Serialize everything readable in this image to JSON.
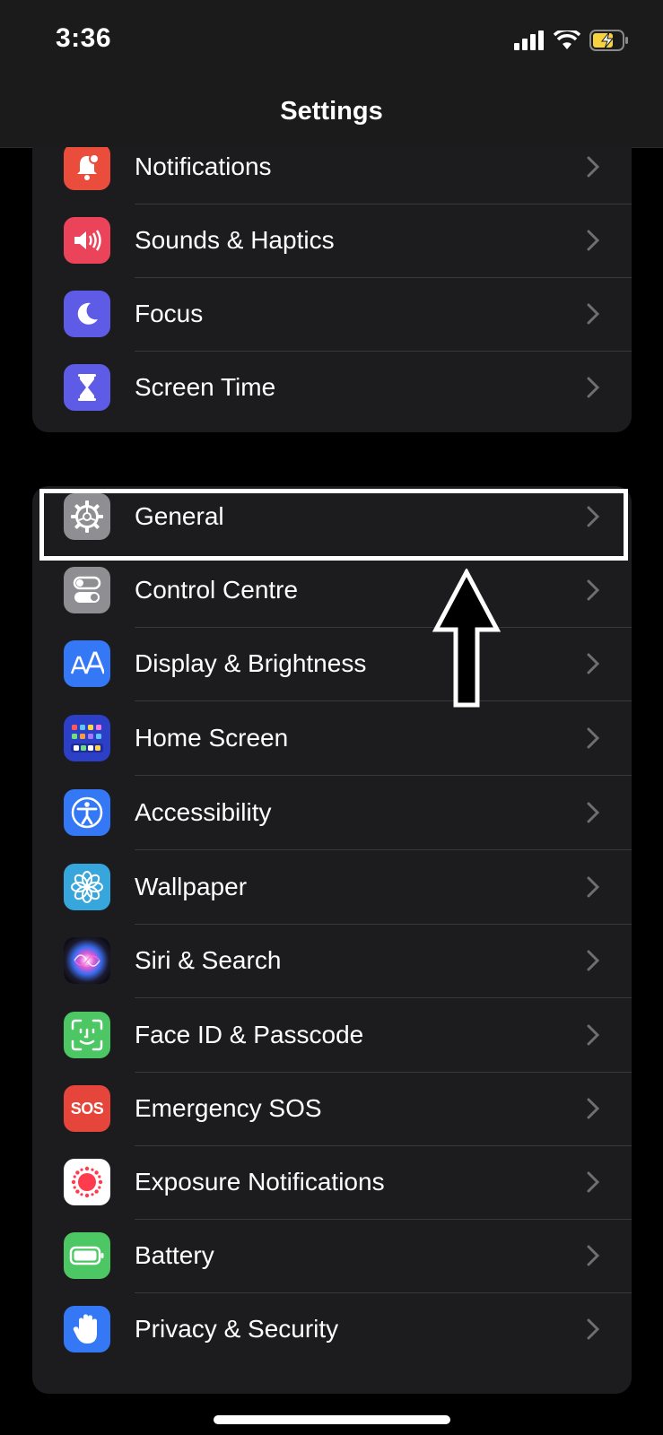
{
  "status": {
    "time": "3:36"
  },
  "header": {
    "title": "Settings"
  },
  "group1": [
    {
      "label": "Notifications",
      "icon": "bell-icon",
      "color": "#eb4d3d"
    },
    {
      "label": "Sounds & Haptics",
      "icon": "speaker-icon",
      "color": "#eb445a"
    },
    {
      "label": "Focus",
      "icon": "moon-icon",
      "color": "#5e5ce6"
    },
    {
      "label": "Screen Time",
      "icon": "hourglass-icon",
      "color": "#5e5ce6"
    }
  ],
  "group2": [
    {
      "label": "General",
      "icon": "gear-icon",
      "color": "#8e8e93"
    },
    {
      "label": "Control Centre",
      "icon": "toggles-icon",
      "color": "#8e8e93"
    },
    {
      "label": "Display & Brightness",
      "icon": "text-size-icon",
      "color": "#3478f6"
    },
    {
      "label": "Home Screen",
      "icon": "home-grid-icon",
      "color": "#2c3fc7"
    },
    {
      "label": "Accessibility",
      "icon": "accessibility-icon",
      "color": "#3478f6"
    },
    {
      "label": "Wallpaper",
      "icon": "flower-icon",
      "color": "#37a6dc"
    },
    {
      "label": "Siri & Search",
      "icon": "siri-icon",
      "color": "#1a1a2e"
    },
    {
      "label": "Face ID & Passcode",
      "icon": "face-id-icon",
      "color": "#4cc764"
    },
    {
      "label": "Emergency SOS",
      "icon": "sos-icon",
      "color": "#e5453a",
      "badge": "SOS"
    },
    {
      "label": "Exposure Notifications",
      "icon": "exposure-icon",
      "color": "#ffffff"
    },
    {
      "label": "Battery",
      "icon": "battery-icon",
      "color": "#4cc764"
    },
    {
      "label": "Privacy & Security",
      "icon": "hand-icon",
      "color": "#3478f6"
    }
  ]
}
